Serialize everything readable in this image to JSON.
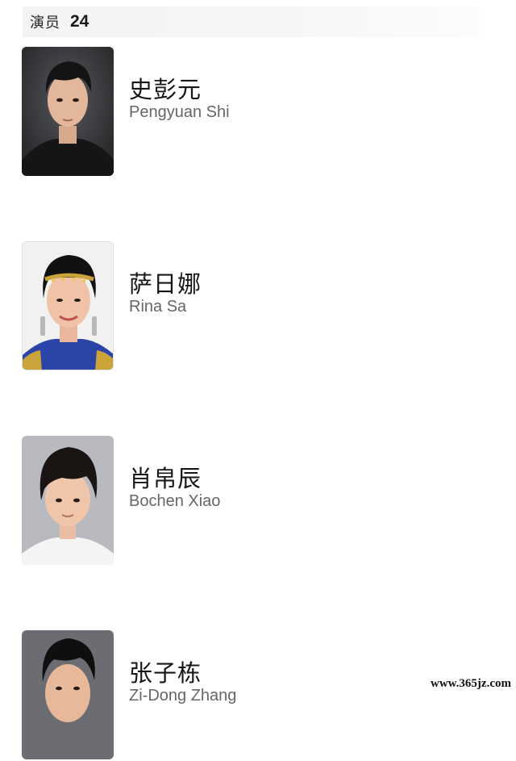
{
  "header": {
    "label": "演员",
    "count": "24"
  },
  "cast": [
    {
      "name_cn": "史彭元",
      "name_en": "Pengyuan Shi",
      "photo": "actor-portrait-icon"
    },
    {
      "name_cn": "萨日娜",
      "name_en": "Rina Sa",
      "photo": "actress-portrait-icon"
    },
    {
      "name_cn": "肖帛辰",
      "name_en": "Bochen Xiao",
      "photo": "child-actor-portrait-icon"
    },
    {
      "name_cn": "张子栋",
      "name_en": "Zi-Dong Zhang",
      "photo": "actor-portrait-icon"
    }
  ],
  "watermark": "www.365jz.com"
}
